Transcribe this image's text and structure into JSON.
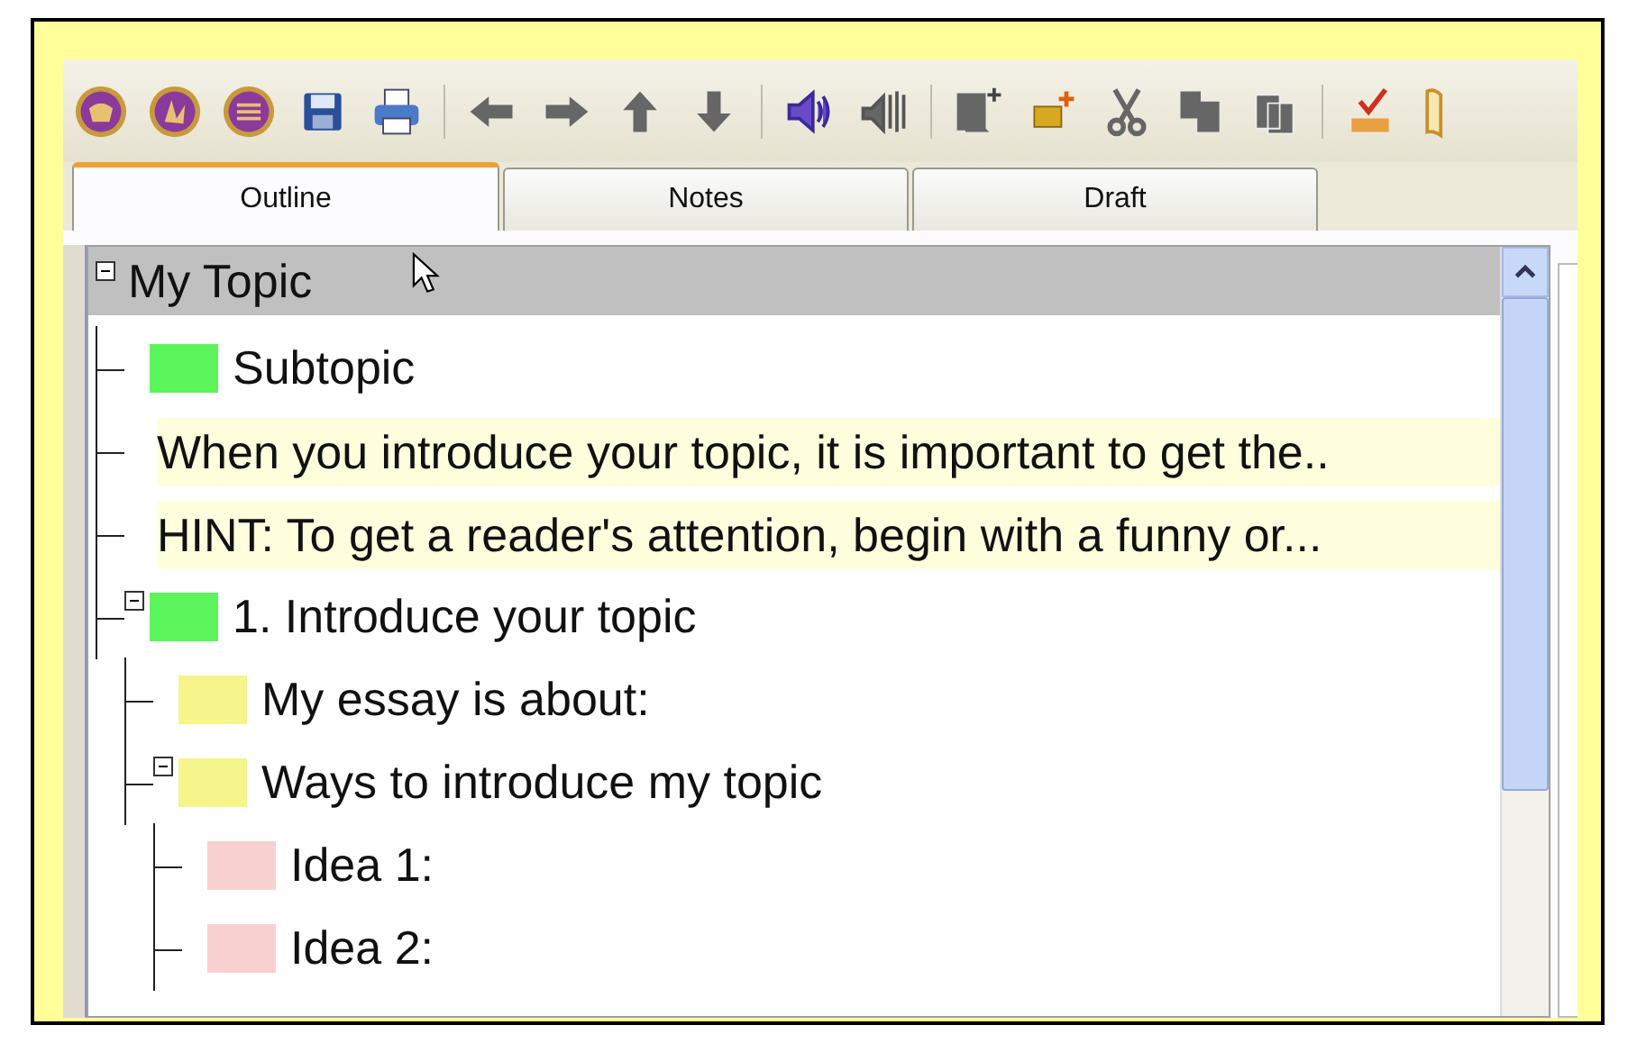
{
  "toolbar": {
    "icons": [
      {
        "kind": "orb"
      },
      {
        "kind": "orb-hand"
      },
      {
        "kind": "orb-lines"
      },
      {
        "kind": "save"
      },
      {
        "kind": "print"
      },
      {
        "kind": "sep"
      },
      {
        "kind": "left"
      },
      {
        "kind": "right"
      },
      {
        "kind": "up"
      },
      {
        "kind": "down"
      },
      {
        "kind": "sep"
      },
      {
        "kind": "speaker"
      },
      {
        "kind": "speaker-mute"
      },
      {
        "kind": "sep"
      },
      {
        "kind": "add-subtopic"
      },
      {
        "kind": "add-note"
      },
      {
        "kind": "cut"
      },
      {
        "kind": "copy"
      },
      {
        "kind": "paste"
      },
      {
        "kind": "sep"
      },
      {
        "kind": "spell"
      },
      {
        "kind": "book"
      }
    ]
  },
  "tabs": [
    {
      "label": "Outline",
      "selected": true
    },
    {
      "label": "Notes",
      "selected": false
    },
    {
      "label": "Draft",
      "selected": false
    }
  ],
  "outline": {
    "items": [
      {
        "text": "My Topic",
        "kind": "topic",
        "selected": true,
        "expanded": true,
        "children": [
          {
            "text": "Subtopic",
            "kind": "topic",
            "color": "#5cf55c",
            "selected": false
          },
          {
            "text": "When you introduce your topic, it is important to get the..",
            "kind": "note",
            "selected": false
          },
          {
            "text": "HINT: To get a reader's attention, begin with a funny or...",
            "kind": "note",
            "selected": false
          },
          {
            "text": "1. Introduce your topic",
            "kind": "topic",
            "color": "#5cf55c",
            "selected": false,
            "expanded": true,
            "children": [
              {
                "text": "My essay is about:",
                "kind": "topic",
                "color": "#f5f58c",
                "selected": false
              },
              {
                "text": "Ways to introduce my topic",
                "kind": "topic",
                "color": "#f5f58c",
                "selected": false,
                "expanded": true,
                "children": [
                  {
                    "text": "Idea 1:",
                    "kind": "topic",
                    "color": "#f8d0d0",
                    "selected": false
                  },
                  {
                    "text": "Idea 2:",
                    "kind": "topic",
                    "color": "#f8d0d0",
                    "selected": false
                  }
                ]
              }
            ]
          }
        ]
      }
    ]
  }
}
